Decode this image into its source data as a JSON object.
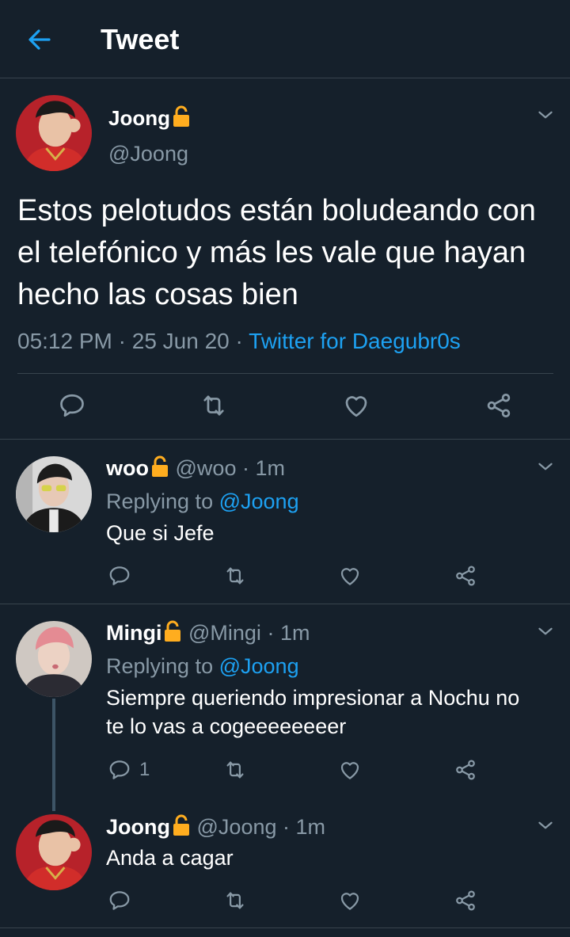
{
  "header": {
    "title": "Tweet"
  },
  "main_tweet": {
    "display_name": "Joong",
    "handle": "@Joong",
    "text": "Estos pelotudos están boludeando con el telefónico y más les vale que hayan hecho las cosas bien",
    "time": "05:12 PM",
    "date": "25 Jun 20",
    "client": "Twitter for Daegubr0s",
    "dot": "·"
  },
  "replies": [
    {
      "display_name": "woo",
      "handle": "@woo",
      "time": "1m",
      "replying_prefix": "Replying to",
      "replying_to": "@Joong",
      "text": "Que si Jefe",
      "reply_count": ""
    },
    {
      "display_name": "Mingi",
      "handle": "@Mingi",
      "time": "1m",
      "replying_prefix": "Replying to",
      "replying_to": "@Joong",
      "text_line1": "Siempre queriendo impresionar a Nochu no",
      "text_line2": "te lo vas a cogeeeeeeeer",
      "reply_count": "1"
    },
    {
      "display_name": "Joong",
      "handle": "@Joong",
      "time": "1m",
      "text": "Anda a cagar",
      "reply_count": ""
    }
  ],
  "colors": {
    "background": "#15202b",
    "accent": "#1da1f2",
    "muted": "#8899a6",
    "divider": "#38444d",
    "lock": "#ffad1f"
  },
  "icons": [
    "back-arrow-icon",
    "lock-icon",
    "chevron-down-icon",
    "reply-icon",
    "retweet-icon",
    "like-icon",
    "share-icon"
  ]
}
